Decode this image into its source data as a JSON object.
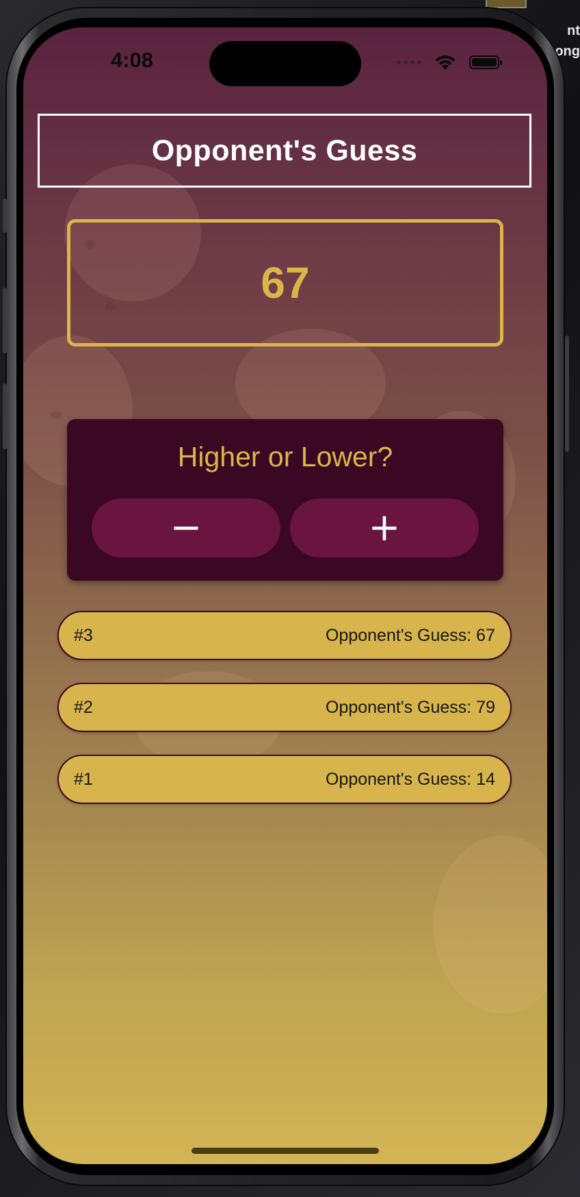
{
  "status_bar": {
    "time": "4:08"
  },
  "background_text": [
    "nt",
    "ong"
  ],
  "game": {
    "title": "Opponent's Guess",
    "current_guess": "67",
    "prompt": "Higher or Lower?",
    "lower_button": "−",
    "higher_button": "+"
  },
  "log": [
    {
      "round": "#3",
      "text": "Opponent's Guess: 67"
    },
    {
      "round": "#2",
      "text": "Opponent's Guess: 79"
    },
    {
      "round": "#1",
      "text": "Opponent's Guess: 14"
    }
  ],
  "colors": {
    "accent_gold": "#dcb549",
    "primary_dark": "#3a0823",
    "button": "#6a1440",
    "log_item": "#d7b54c"
  }
}
